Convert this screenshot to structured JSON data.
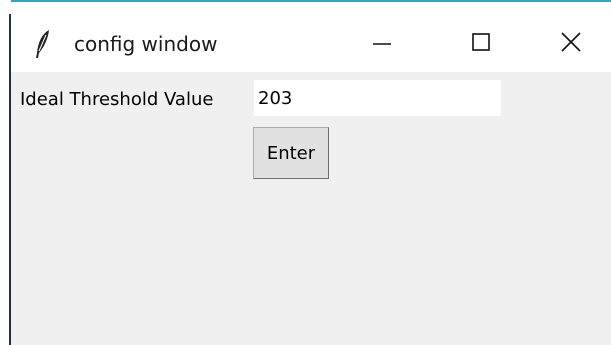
{
  "window": {
    "title": "config window",
    "app_icon": "feather-icon",
    "controls": {
      "minimize_icon": "minimize-icon",
      "maximize_icon": "maximize-icon",
      "close_icon": "close-icon"
    }
  },
  "form": {
    "threshold_label": "Ideal Threshold Value",
    "threshold_value": "203",
    "enter_label": "Enter"
  },
  "colors": {
    "titlebar_bg": "#ffffff",
    "window_bg": "#f0f0f0",
    "button_bg": "#e1e1e1",
    "accent_border": "#2fa6c9"
  }
}
